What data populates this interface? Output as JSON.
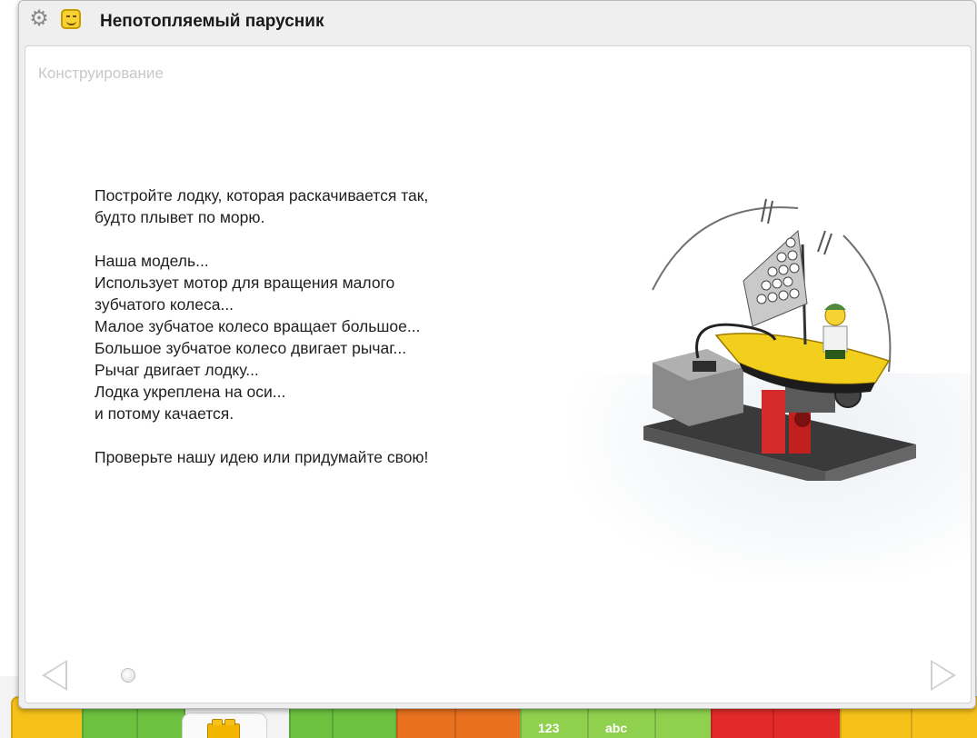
{
  "window": {
    "title": "Непотопляемый парусник",
    "icons": [
      "gear-icon",
      "smiley-face-icon"
    ]
  },
  "content": {
    "section_title": "Конструирование",
    "paragraphs": [
      [
        "Постройте лодку, которая раскачивается так,",
        "будто плывет по морю."
      ],
      [
        "Наша модель...",
        "Использует мотор для вращения малого",
        "зубчатого колеса...",
        "Малое зубчатое колесо вращает большое...",
        "Большое зубчатое колесо двигает рычаг...",
        "Рычаг двигает лодку...",
        "Лодка укреплена на оси...",
        "и потому качается."
      ],
      [
        "Проверьте нашу идею или придумайте свою!"
      ]
    ],
    "image": "lego-sailboat-model-illustration"
  },
  "navigation": {
    "prev": "previous-page-arrow",
    "next": "next-page-arrow",
    "page_count": 1,
    "current_page": 1
  },
  "palette": {
    "labels": [
      "123",
      "abc"
    ],
    "colors": {
      "green": "#6cc23f",
      "orange": "#e8701e",
      "light_green": "#8fd14f",
      "red": "#e32a2a",
      "yellow": "#f6c21a"
    }
  }
}
